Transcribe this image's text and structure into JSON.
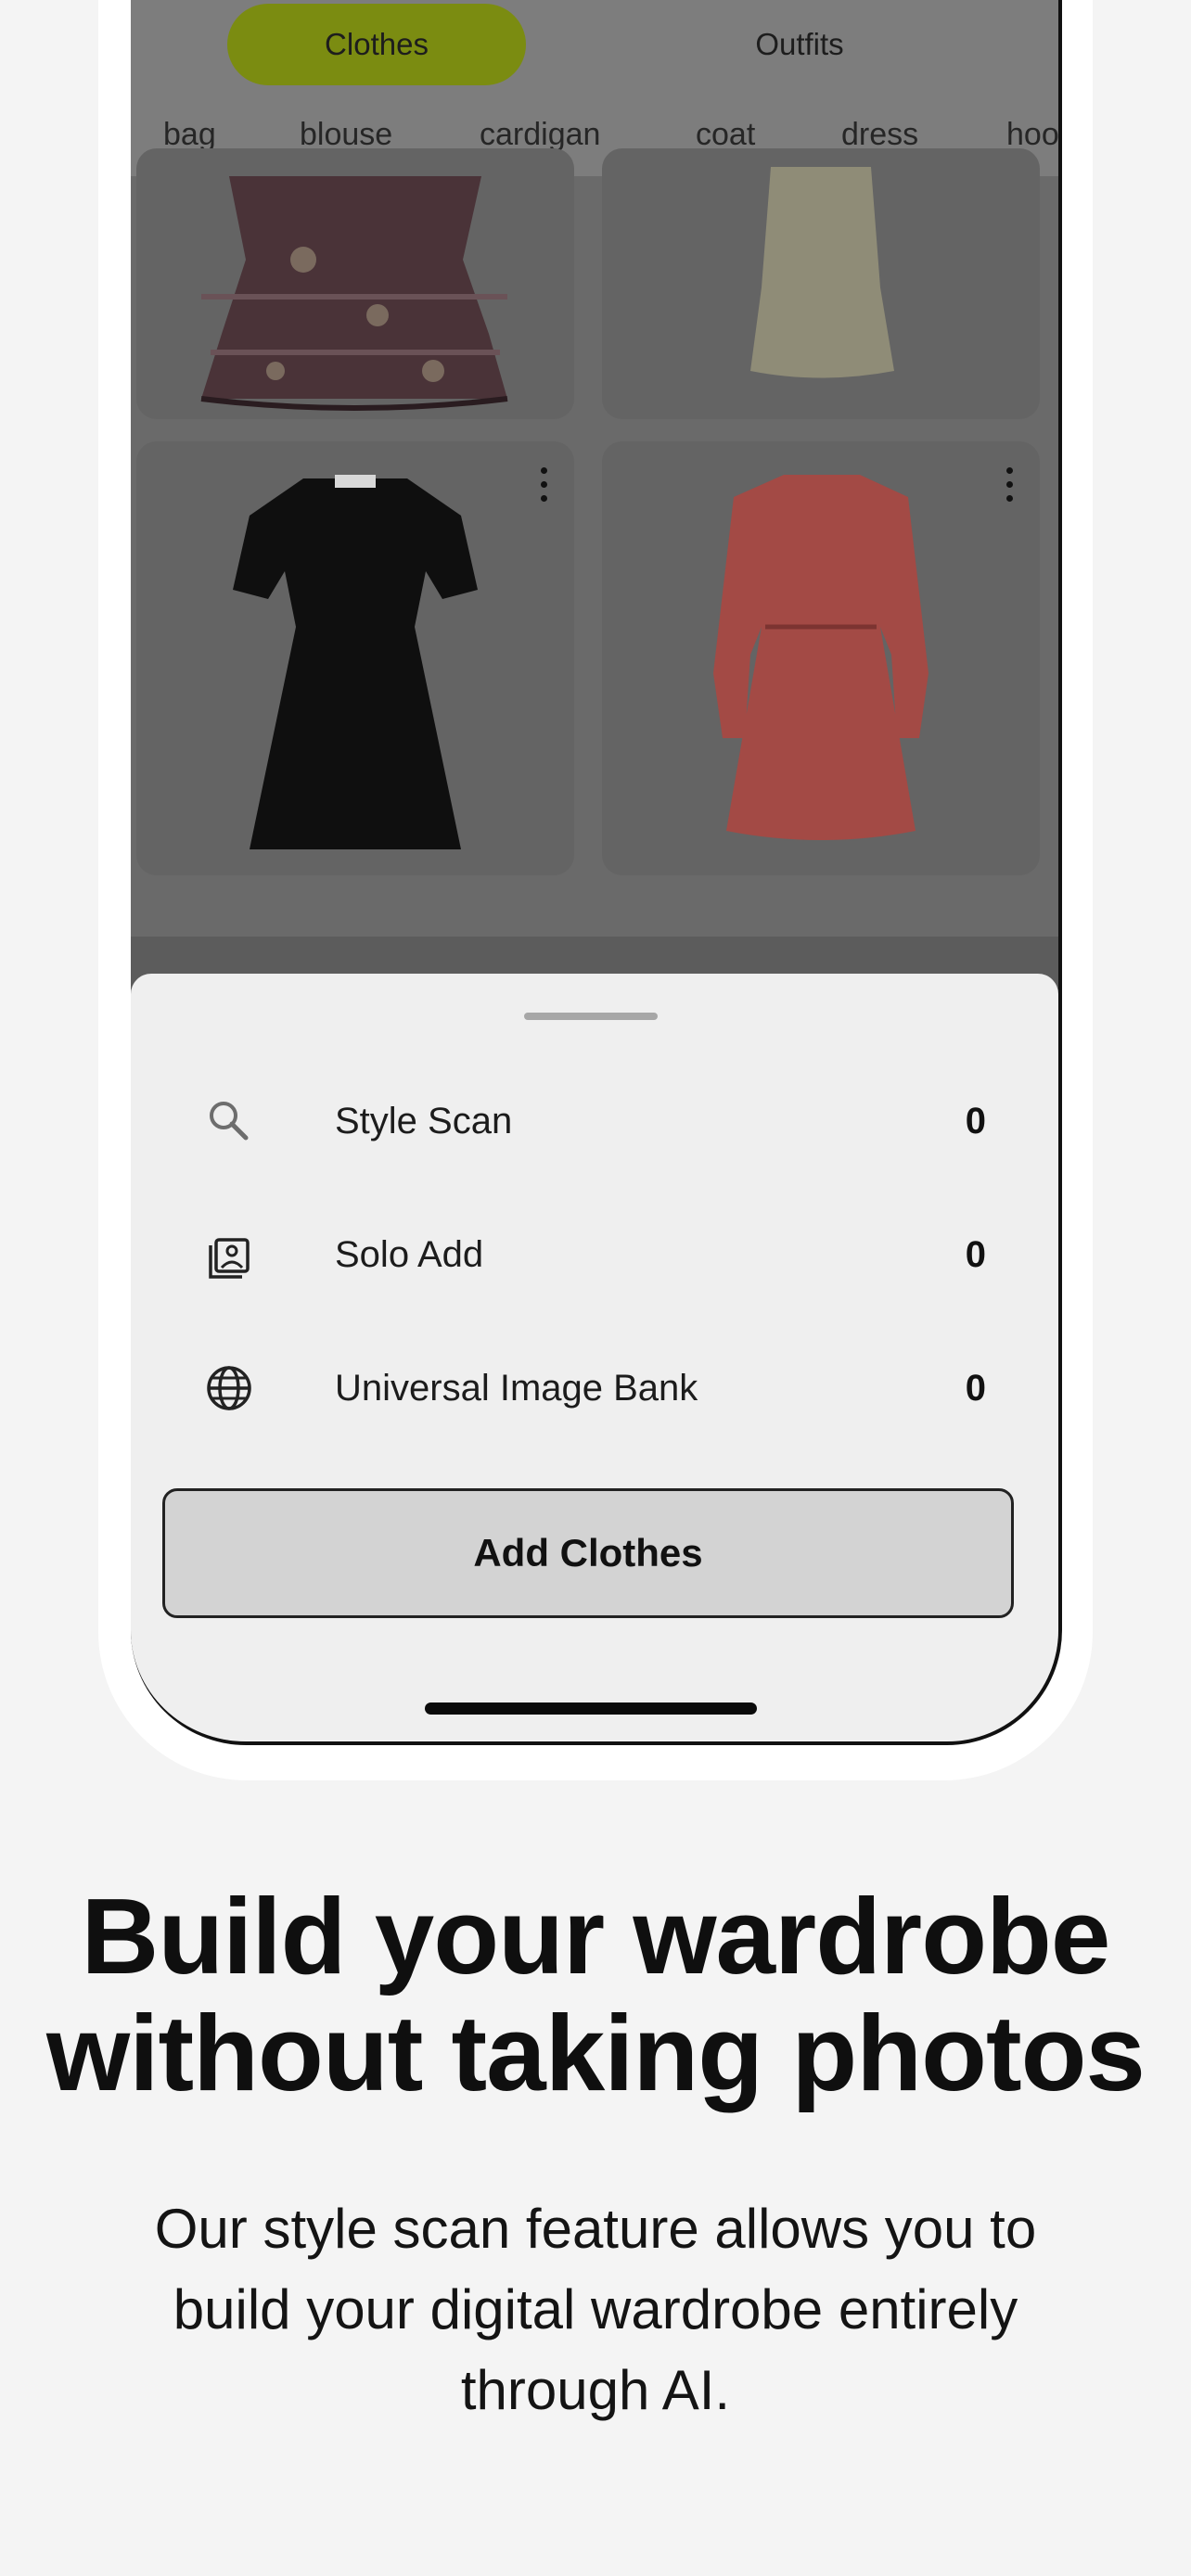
{
  "app": {
    "segments": {
      "active": "Clothes",
      "inactive": "Outfits"
    },
    "categories": [
      "bag",
      "blouse",
      "cardigan",
      "coat",
      "dress",
      "hoo"
    ]
  },
  "grid": {
    "items": [
      {
        "name": "tiered-paisley-dress",
        "color": "#5a3f44"
      },
      {
        "name": "cream-slip-dress",
        "color": "#b9b69d"
      },
      {
        "name": "black-button-dress",
        "color": "#121212"
      },
      {
        "name": "red-floral-dress",
        "color": "#b8544f"
      }
    ]
  },
  "sheet": {
    "rows": [
      {
        "icon": "search-icon",
        "label": "Style Scan",
        "count": "0"
      },
      {
        "icon": "image-gallery-icon",
        "label": "Solo Add",
        "count": "0"
      },
      {
        "icon": "globe-icon",
        "label": "Universal Image Bank",
        "count": "0"
      }
    ],
    "button_label": "Add Clothes"
  },
  "marketing": {
    "headline_line1": "Build your wardrobe",
    "headline_line2": "without taking photos",
    "body_line1": "Our style scan feature allows you to",
    "body_line2": "build your digital wardrobe entirely",
    "body_line3": "through AI."
  },
  "colors": {
    "accent": "#8ea512",
    "page_background": "#f4f4f4",
    "sheet_background": "#efefef"
  }
}
